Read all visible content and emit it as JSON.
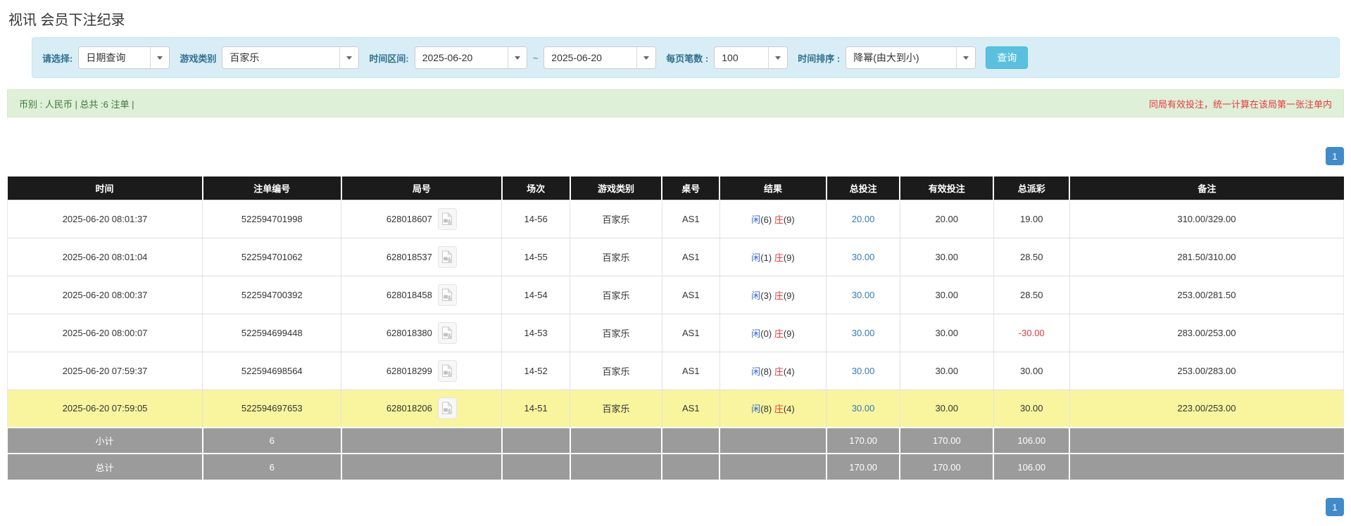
{
  "page": {
    "title": "视讯 会员下注纪录"
  },
  "filters": {
    "select_label": "请选择:",
    "select_value": "日期查询",
    "game_type_label": "游戏类别",
    "game_type_value": "百家乐",
    "time_range_label": "时间区间:",
    "date_from": "2025-06-20",
    "date_tilde": "~",
    "date_to": "2025-06-20",
    "page_size_label": "每页笔数 :",
    "page_size_value": "100",
    "sort_label": "时间排序 :",
    "sort_value": "降幂(由大到小)",
    "search_button": "查询"
  },
  "summary_bar": {
    "left_text": "币别 : 人民币 | 总共 :6 注单 |",
    "right_text": "同局有效投注，统一计算在该局第一张注单内"
  },
  "pagination": {
    "page": "1"
  },
  "table": {
    "headers": [
      "时间",
      "注单编号",
      "局号",
      "场次",
      "游戏类别",
      "桌号",
      "结果",
      "总投注",
      "有效投注",
      "总派彩",
      "备注"
    ],
    "rows": [
      {
        "time": "2025-06-20 08:01:37",
        "bet_id": "522594701998",
        "round_id": "628018607",
        "session": "14-56",
        "game": "百家乐",
        "table_no": "AS1",
        "result": {
          "player": "闲",
          "player_score": "(6)",
          "banker": "庄",
          "banker_score": "(9)"
        },
        "total_bet": "20.00",
        "valid_bet": "20.00",
        "payout": "19.00",
        "payout_negative": false,
        "remark": "310.00/329.00",
        "highlighted": false
      },
      {
        "time": "2025-06-20 08:01:04",
        "bet_id": "522594701062",
        "round_id": "628018537",
        "session": "14-55",
        "game": "百家乐",
        "table_no": "AS1",
        "result": {
          "player": "闲",
          "player_score": "(1)",
          "banker": "庄",
          "banker_score": "(9)"
        },
        "total_bet": "30.00",
        "valid_bet": "30.00",
        "payout": "28.50",
        "payout_negative": false,
        "remark": "281.50/310.00",
        "highlighted": false
      },
      {
        "time": "2025-06-20 08:00:37",
        "bet_id": "522594700392",
        "round_id": "628018458",
        "session": "14-54",
        "game": "百家乐",
        "table_no": "AS1",
        "result": {
          "player": "闲",
          "player_score": "(3)",
          "banker": "庄",
          "banker_score": "(9)"
        },
        "total_bet": "30.00",
        "valid_bet": "30.00",
        "payout": "28.50",
        "payout_negative": false,
        "remark": "253.00/281.50",
        "highlighted": false
      },
      {
        "time": "2025-06-20 08:00:07",
        "bet_id": "522594699448",
        "round_id": "628018380",
        "session": "14-53",
        "game": "百家乐",
        "table_no": "AS1",
        "result": {
          "player": "闲",
          "player_score": "(0)",
          "banker": "庄",
          "banker_score": "(9)"
        },
        "total_bet": "30.00",
        "valid_bet": "30.00",
        "payout": "-30.00",
        "payout_negative": true,
        "remark": "283.00/253.00",
        "highlighted": false
      },
      {
        "time": "2025-06-20 07:59:37",
        "bet_id": "522594698564",
        "round_id": "628018299",
        "session": "14-52",
        "game": "百家乐",
        "table_no": "AS1",
        "result": {
          "player": "闲",
          "player_score": "(8)",
          "banker": "庄",
          "banker_score": "(4)"
        },
        "total_bet": "30.00",
        "valid_bet": "30.00",
        "payout": "30.00",
        "payout_negative": false,
        "remark": "253.00/283.00",
        "highlighted": false
      },
      {
        "time": "2025-06-20 07:59:05",
        "bet_id": "522594697653",
        "round_id": "628018206",
        "session": "14-51",
        "game": "百家乐",
        "table_no": "AS1",
        "result": {
          "player": "闲",
          "player_score": "(8)",
          "banker": "庄",
          "banker_score": "(4)"
        },
        "total_bet": "30.00",
        "valid_bet": "30.00",
        "payout": "30.00",
        "payout_negative": false,
        "remark": "223.00/253.00",
        "highlighted": true
      }
    ],
    "subtotal": {
      "label": "小计",
      "count": "6",
      "total_bet": "170.00",
      "valid_bet": "170.00",
      "payout": "106.00"
    },
    "total": {
      "label": "总计",
      "count": "6",
      "total_bet": "170.00",
      "valid_bet": "170.00",
      "payout": "106.00"
    }
  },
  "icons": {
    "dropdown_arrow": "chevron-down-icon",
    "round_video": "video-record-icon"
  },
  "colors": {
    "filter_bg": "#d9edf7",
    "filter_border": "#bce8f1",
    "filter_label": "#31708f",
    "search_button": "#5bc0de",
    "summary_bg": "#dff0d8",
    "summary_text": "#3c763d",
    "summary_note": "#e4393c",
    "header_bg": "#1b1b1b",
    "footer_row_bg": "#9b9b9b",
    "highlight_row": "#f8f59e",
    "link_blue": "#337ab7",
    "player_blue": "#3366cc",
    "banker_red": "#e4393c",
    "pagination_blue": "#428bca"
  }
}
